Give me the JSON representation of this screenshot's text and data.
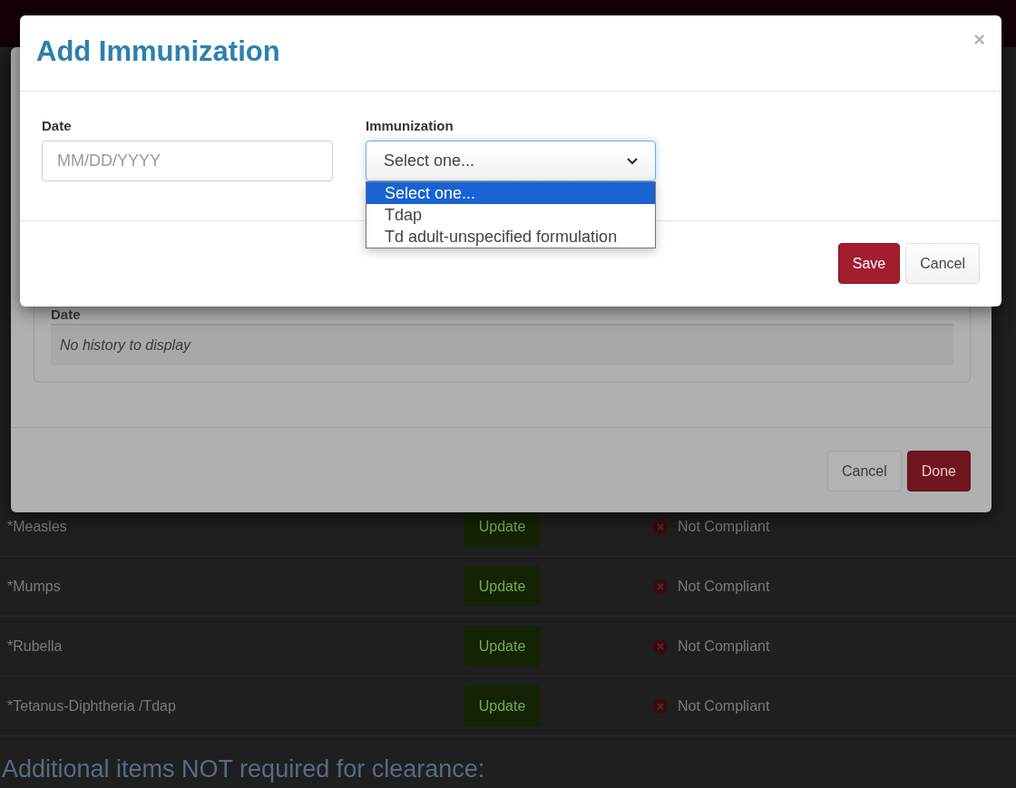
{
  "background_page": {
    "rows": [
      {
        "name": "*Measles",
        "action": "Update",
        "status": "Not Compliant"
      },
      {
        "name": "*Mumps",
        "action": "Update",
        "status": "Not Compliant"
      },
      {
        "name": "*Rubella",
        "action": "Update",
        "status": "Not Compliant"
      },
      {
        "name": "*Tetanus-Diphtheria /Tdap",
        "action": "Update",
        "status": "Not Compliant"
      }
    ],
    "section_heading": "Additional items NOT required for clearance:"
  },
  "history_dialog": {
    "column_header": "Date",
    "empty_message": "No history to display",
    "buttons": [
      {
        "label": "Cancel",
        "kind": "default"
      },
      {
        "label": "Done",
        "kind": "primary"
      }
    ]
  },
  "add_dialog": {
    "title": "Add Immunization",
    "close": "×",
    "date_label": "Date",
    "date_placeholder": "MM/DD/YYYY",
    "immunization_label": "Immunization",
    "immunization_value": "Select one...",
    "options": [
      {
        "label": "Select one...",
        "selected": true
      },
      {
        "label": "Tdap",
        "selected": false
      },
      {
        "label": "Td adult-unspecified formulation",
        "selected": false
      }
    ],
    "buttons": [
      {
        "label": "Save",
        "kind": "primary"
      },
      {
        "label": "Cancel",
        "kind": "default"
      }
    ]
  }
}
